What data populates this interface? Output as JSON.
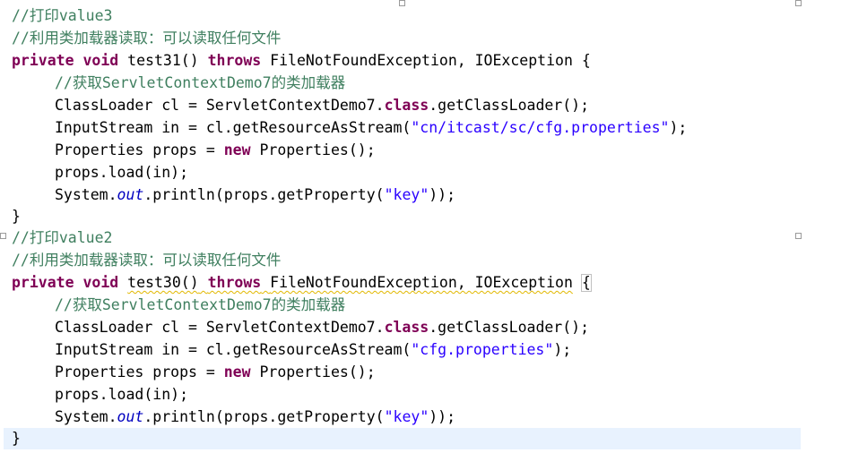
{
  "editor": {
    "block1": {
      "comment_print": "//打印value3",
      "comment_desc": "//利用类加载器读取：可以读取任何文件",
      "sig": {
        "kw_private": "private",
        "kw_void": "void",
        "name": "test31()",
        "kw_throws": "throws",
        "exceptions": "FileNotFoundException, IOException {"
      },
      "comment_get": "//获取ServletContextDemo7的类加载器",
      "l_cl": {
        "pre": "ClassLoader cl = ServletContextDemo7.",
        "kw": "class",
        "post": ".getClassLoader();"
      },
      "l_in": {
        "pre": "InputStream in = cl.getResourceAsStream(",
        "str": "\"cn/itcast/sc/cfg.properties\"",
        "post": ");"
      },
      "l_props": {
        "pre": "Properties props = ",
        "kw": "new",
        "post": " Properties();"
      },
      "l_load": "props.load(in);",
      "l_print": {
        "pre": "System.",
        "field": "out",
        "mid": ".println(props.getProperty(",
        "str": "\"key\"",
        "post": "));"
      },
      "close": "}"
    },
    "block2": {
      "comment_print": "//打印value2",
      "comment_desc": "//利用类加载器读取：可以读取任何文件",
      "sig": {
        "kw_private": "private",
        "kw_void": "void",
        "name": "test30()",
        "kw_throws": "throws",
        "exceptions": "FileNotFoundException, IOException",
        "brace": "{"
      },
      "comment_get": "//获取ServletContextDemo7的类加载器",
      "l_cl": {
        "pre": "ClassLoader cl = ServletContextDemo7.",
        "kw": "class",
        "post": ".getClassLoader();"
      },
      "l_in": {
        "pre": "InputStream in = cl.getResourceAsStream(",
        "str": "\"cfg.properties\"",
        "post": ");"
      },
      "l_props": {
        "pre": "Properties props = ",
        "kw": "new",
        "post": " Properties();"
      },
      "l_load": "props.load(in);",
      "l_print": {
        "pre": "System.",
        "field": "out",
        "mid": ".println(props.getProperty(",
        "str": "\"key\"",
        "post": "));"
      },
      "close": "}"
    }
  }
}
